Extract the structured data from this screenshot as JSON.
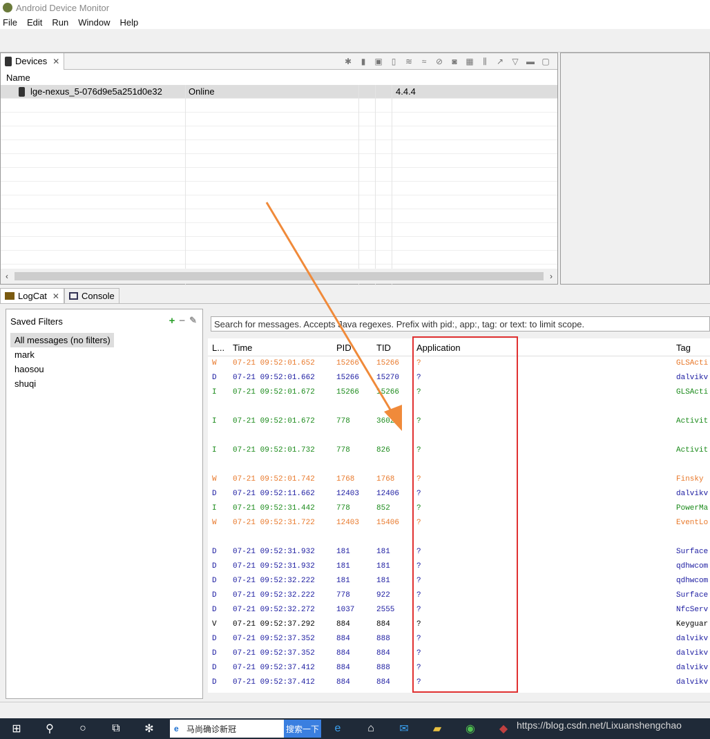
{
  "window": {
    "title": "Android Device Monitor"
  },
  "menu": [
    "File",
    "Edit",
    "Run",
    "Window",
    "Help"
  ],
  "devices_panel": {
    "tab_label": "Devices",
    "column_name": "Name",
    "device": {
      "name": "lge-nexus_5-076d9e5a251d0e32",
      "status": "Online",
      "version": "4.4.4"
    }
  },
  "logcat_tabs": {
    "logcat": "LogCat",
    "console": "Console"
  },
  "saved_filters": {
    "title": "Saved Filters",
    "items": [
      "All messages (no filters)",
      "mark",
      "haosou",
      "shuqi"
    ]
  },
  "search": {
    "placeholder": "Search for messages. Accepts Java regexes. Prefix with pid:, app:, tag: or text: to limit scope."
  },
  "log_columns": {
    "level": "L...",
    "time": "Time",
    "pid": "PID",
    "tid": "TID",
    "application": "Application",
    "tag": "Tag"
  },
  "colors": {
    "W": "#e8782a",
    "D": "#1a1aa0",
    "I": "#1a8a1a",
    "V": "#000000",
    "highlight": "#e03030",
    "arrow": "#f08a3a"
  },
  "log_rows": [
    {
      "level": "W",
      "time": "07-21 09:52:01.652",
      "pid": "15266",
      "tid": "15266",
      "app": "?",
      "tag": "GLSActi"
    },
    {
      "level": "D",
      "time": "07-21 09:52:01.662",
      "pid": "15266",
      "tid": "15270",
      "app": "?",
      "tag": "dalvikv"
    },
    {
      "level": "I",
      "time": "07-21 09:52:01.672",
      "pid": "15266",
      "tid": "15266",
      "app": "?",
      "tag": "GLSActi"
    },
    {
      "level": "",
      "time": "",
      "pid": "",
      "tid": "",
      "app": "",
      "tag": ""
    },
    {
      "level": "I",
      "time": "07-21 09:52:01.672",
      "pid": "778",
      "tid": "3602",
      "app": "?",
      "tag": "Activit"
    },
    {
      "level": "",
      "time": "",
      "pid": "",
      "tid": "",
      "app": "",
      "tag": ""
    },
    {
      "level": "I",
      "time": "07-21 09:52:01.732",
      "pid": "778",
      "tid": "826",
      "app": "?",
      "tag": "Activit"
    },
    {
      "level": "",
      "time": "",
      "pid": "",
      "tid": "",
      "app": "",
      "tag": ""
    },
    {
      "level": "W",
      "time": "07-21 09:52:01.742",
      "pid": "1768",
      "tid": "1768",
      "app": "?",
      "tag": "Finsky"
    },
    {
      "level": "D",
      "time": "07-21 09:52:11.662",
      "pid": "12403",
      "tid": "12406",
      "app": "?",
      "tag": "dalvikv"
    },
    {
      "level": "I",
      "time": "07-21 09:52:31.442",
      "pid": "778",
      "tid": "852",
      "app": "?",
      "tag": "PowerMa"
    },
    {
      "level": "W",
      "time": "07-21 09:52:31.722",
      "pid": "12403",
      "tid": "15406",
      "app": "?",
      "tag": "EventLo"
    },
    {
      "level": "",
      "time": "",
      "pid": "",
      "tid": "",
      "app": "",
      "tag": ""
    },
    {
      "level": "D",
      "time": "07-21 09:52:31.932",
      "pid": "181",
      "tid": "181",
      "app": "?",
      "tag": "Surface"
    },
    {
      "level": "D",
      "time": "07-21 09:52:31.932",
      "pid": "181",
      "tid": "181",
      "app": "?",
      "tag": "qdhwcom"
    },
    {
      "level": "D",
      "time": "07-21 09:52:32.222",
      "pid": "181",
      "tid": "181",
      "app": "?",
      "tag": "qdhwcom"
    },
    {
      "level": "D",
      "time": "07-21 09:52:32.222",
      "pid": "778",
      "tid": "922",
      "app": "?",
      "tag": "Surface"
    },
    {
      "level": "D",
      "time": "07-21 09:52:32.272",
      "pid": "1037",
      "tid": "2555",
      "app": "?",
      "tag": "NfcServ"
    },
    {
      "level": "V",
      "time": "07-21 09:52:37.292",
      "pid": "884",
      "tid": "884",
      "app": "?",
      "tag": "Keyguar"
    },
    {
      "level": "D",
      "time": "07-21 09:52:37.352",
      "pid": "884",
      "tid": "888",
      "app": "?",
      "tag": "dalvikv"
    },
    {
      "level": "D",
      "time": "07-21 09:52:37.352",
      "pid": "884",
      "tid": "884",
      "app": "?",
      "tag": "dalvikv"
    },
    {
      "level": "D",
      "time": "07-21 09:52:37.412",
      "pid": "884",
      "tid": "888",
      "app": "?",
      "tag": "dalvikv"
    },
    {
      "level": "D",
      "time": "07-21 09:52:37.412",
      "pid": "884",
      "tid": "884",
      "app": "?",
      "tag": "dalvikv"
    }
  ],
  "taskbar": {
    "search_text": "马尚确诊新冠",
    "search_button": "搜索一下"
  },
  "watermark": "https://blog.csdn.net/Lixuanshengchao"
}
